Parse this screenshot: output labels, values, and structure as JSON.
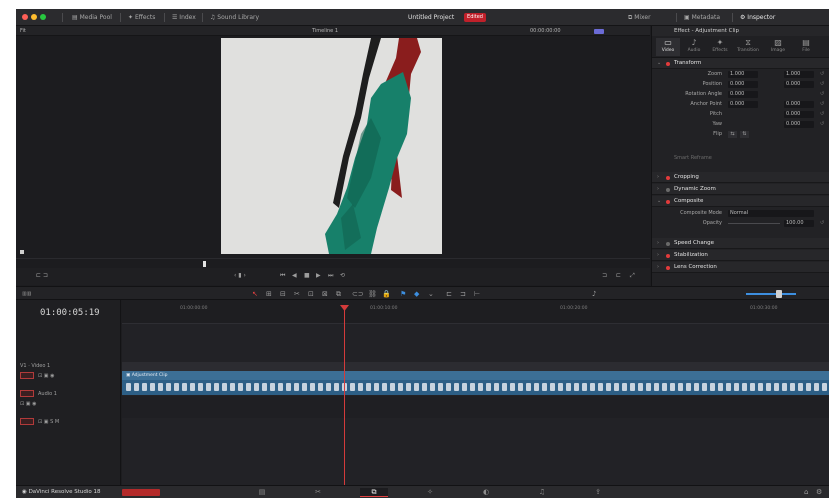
{
  "titlebar": {
    "items": [
      "Media Pool",
      "Effects",
      "Index",
      "Sound Library"
    ],
    "center_title": "Untitled Project",
    "badge": "Edited",
    "right_items": [
      "Mixer",
      "Metadata",
      "Inspector"
    ]
  },
  "viewer_bar": {
    "left_text": "Fit",
    "center_text": "Timeline 1",
    "right_text": "00:00:00:00"
  },
  "inspector": {
    "header": "Effect - Adjustment Clip",
    "tabs": [
      "Video",
      "Audio",
      "Effects",
      "Transition",
      "Image",
      "File"
    ],
    "sections": {
      "transform": "Transform",
      "cropping": "Cropping",
      "dynamic_zoom": "Dynamic Zoom",
      "composite": "Composite",
      "speed_change": "Speed Change",
      "stabilization": "Stabilization",
      "lens_correction": "Lens Correction"
    },
    "transform_rows": [
      {
        "label": "Zoom",
        "x": "1.000",
        "y": "1.000"
      },
      {
        "label": "Position",
        "x": "0.000",
        "y": "0.000"
      },
      {
        "label": "Rotation Angle",
        "x": "0.000",
        "y": ""
      },
      {
        "label": "Anchor Point",
        "x": "0.000",
        "y": "0.000"
      },
      {
        "label": "Pitch",
        "x": "0.000",
        "y": ""
      },
      {
        "label": "Yaw",
        "x": "0.000",
        "y": ""
      },
      {
        "label": "Flip",
        "x": "",
        "y": ""
      }
    ],
    "smart_reframe": "Smart Reframe",
    "composite_rows": [
      {
        "label": "Composite Mode",
        "value": "Normal"
      },
      {
        "label": "Opacity",
        "value": "100.00"
      }
    ]
  },
  "timeline": {
    "timecode": "01:00:05:19",
    "ruler": [
      "01:00:00:00",
      "01:00:10:00",
      "01:00:20:00",
      "01:00:30:00"
    ],
    "tracks": [
      {
        "name": "Video 1",
        "id": "V1"
      },
      {
        "name": "Audio 1",
        "id": "A1"
      }
    ],
    "clip_label": "Adjustment Clip"
  },
  "bottom": {
    "app_name": "DaVinci Resolve Studio 18",
    "badge": "",
    "pages": [
      "media",
      "cut",
      "edit",
      "fusion",
      "color",
      "fairlight",
      "deliver"
    ],
    "active_page": 2
  },
  "colors": {
    "accent_red": "#e04040",
    "clip_blue": "#3c6f96"
  }
}
